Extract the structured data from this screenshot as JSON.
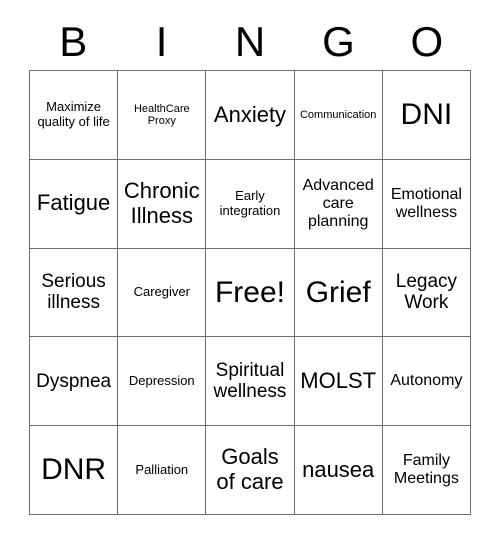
{
  "card": {
    "title_letters": [
      "B",
      "I",
      "N",
      "G",
      "O"
    ],
    "columns": 5,
    "rows": 5,
    "border_color": "#6f6f6f",
    "text_color": "#000000",
    "background_color": "#ffffff",
    "cells": [
      [
        {
          "text": "Maximize quality of life",
          "size": "sm"
        },
        {
          "text": "HealthCare Proxy",
          "size": "xs"
        },
        {
          "text": "Anxiety",
          "size": "xl"
        },
        {
          "text": "Communication",
          "size": "xs"
        },
        {
          "text": "DNI",
          "size": "xxl"
        }
      ],
      [
        {
          "text": "Fatigue",
          "size": "xl"
        },
        {
          "text": "Chronic Illness",
          "size": "xl"
        },
        {
          "text": "Early integration",
          "size": "sm"
        },
        {
          "text": "Advanced care planning",
          "size": "md"
        },
        {
          "text": "Emotional wellness",
          "size": "md"
        }
      ],
      [
        {
          "text": "Serious illness",
          "size": "lg"
        },
        {
          "text": "Caregiver",
          "size": "sm"
        },
        {
          "text": "Free!",
          "size": "xxl"
        },
        {
          "text": "Grief",
          "size": "xxl"
        },
        {
          "text": "Legacy Work",
          "size": "lg"
        }
      ],
      [
        {
          "text": "Dyspnea",
          "size": "lg"
        },
        {
          "text": "Depression",
          "size": "sm"
        },
        {
          "text": "Spiritual wellness",
          "size": "lg"
        },
        {
          "text": "MOLST",
          "size": "xl"
        },
        {
          "text": "Autonomy",
          "size": "md"
        }
      ],
      [
        {
          "text": "DNR",
          "size": "xxl"
        },
        {
          "text": "Palliation",
          "size": "sm"
        },
        {
          "text": "Goals of care",
          "size": "xl"
        },
        {
          "text": "nausea",
          "size": "xl"
        },
        {
          "text": "Family Meetings",
          "size": "md"
        }
      ]
    ]
  }
}
